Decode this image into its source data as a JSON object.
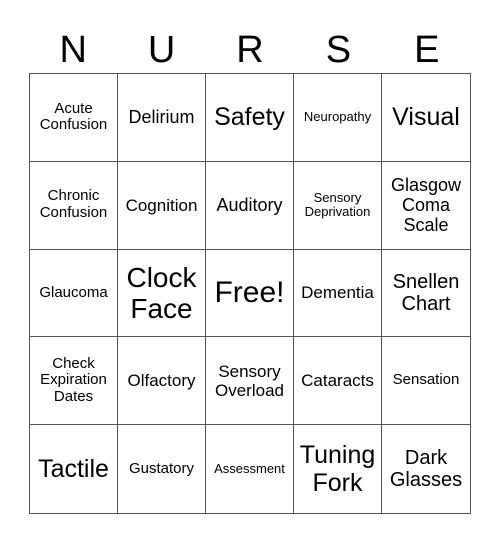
{
  "header": [
    "N",
    "U",
    "R",
    "S",
    "E"
  ],
  "cells": [
    [
      "Acute Confusion",
      "Delirium",
      "Safety",
      "Neuropathy",
      "Visual"
    ],
    [
      "Chronic Confusion",
      "Cognition",
      "Auditory",
      "Sensory Deprivation",
      "Glasgow Coma Scale"
    ],
    [
      "Glaucoma",
      "Clock Face",
      "Free!",
      "Dementia",
      "Snellen Chart"
    ],
    [
      "Check Expiration Dates",
      "Olfactory",
      "Sensory Overload",
      "Cataracts",
      "Sensation"
    ],
    [
      "Tactile",
      "Gustatory",
      "Assessment",
      "Tuning Fork",
      "Dark Glasses"
    ]
  ]
}
